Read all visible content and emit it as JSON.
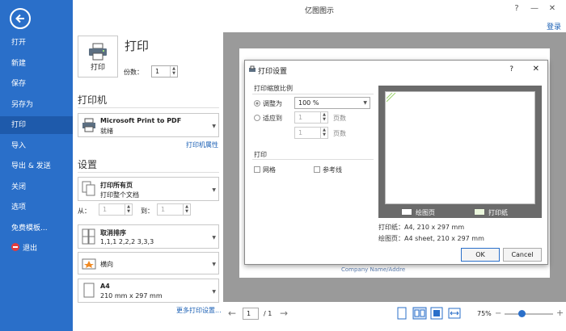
{
  "window": {
    "title": "亿图图示",
    "login": "登录"
  },
  "sidebar": {
    "items": [
      {
        "label": "打开"
      },
      {
        "label": "新建"
      },
      {
        "label": "保存"
      },
      {
        "label": "另存为"
      },
      {
        "label": "打印",
        "active": true
      },
      {
        "label": "导入"
      },
      {
        "label": "导出 & 发送"
      },
      {
        "label": "关闭"
      },
      {
        "label": "选项"
      },
      {
        "label": "免费模板..."
      },
      {
        "label": "退出"
      }
    ]
  },
  "print_panel": {
    "heading": "打印",
    "print_button": "打印",
    "copies_label": "份数：",
    "copies_value": "1",
    "printer_heading": "打印机",
    "printer_name": "Microsoft Print to PDF",
    "printer_status": "就绪",
    "printer_props_link": "打印机属性",
    "settings_heading": "设置",
    "pages_option_title": "打印所有页",
    "pages_option_sub": "打印整个文档",
    "from_label": "从：",
    "from_value": "1",
    "to_label": "到：",
    "to_value": "1",
    "collate_title": "取消排序",
    "collate_sub": "1,1,1   2,2,2   3,3,3",
    "orientation": "横向",
    "paper_title": "A4",
    "paper_sub": "210 mm x 297 mm",
    "more_settings_link": "更多打印设置..."
  },
  "preview": {
    "page_value": "1",
    "page_total": "/ 1",
    "zoom": "75%",
    "zoom_fraction": 0.35,
    "background_text": "Company Name/Addre"
  },
  "dialog": {
    "title": "打印设置",
    "help": "?",
    "close": "✕",
    "scale_group": "打印缩放比例",
    "adjust_label": "调整为",
    "adjust_value": "100 %",
    "fit_label": "适应到",
    "fit_pages_1": "1",
    "fit_pages_2": "1",
    "pages_unit": "页数",
    "print_group": "打印",
    "grid_label": "网格",
    "guides_label": "参考线",
    "legend_drawing_page": "绘图页",
    "legend_print_paper": "打印纸",
    "paper_info": "打印纸：A4, 210 x 297 mm",
    "drawing_info": "绘图页：A4 sheet, 210 x 297 mm",
    "ok": "OK",
    "cancel": "Cancel"
  },
  "colors": {
    "sidebar": "#2a6fc9",
    "sidebar_active": "#1e5aab",
    "link": "#1a5fb4"
  }
}
